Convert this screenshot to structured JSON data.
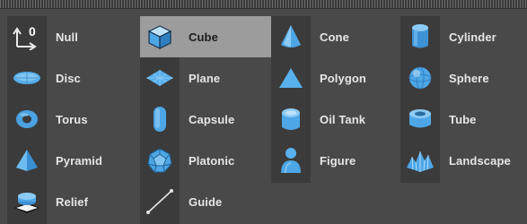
{
  "columns": [
    {
      "items": [
        {
          "label": "Null",
          "icon": "null-icon",
          "glyph": "0"
        },
        {
          "label": "Disc",
          "icon": "disc-icon"
        },
        {
          "label": "Torus",
          "icon": "torus-icon"
        },
        {
          "label": "Pyramid",
          "icon": "pyramid-icon"
        },
        {
          "label": "Relief",
          "icon": "relief-icon"
        }
      ]
    },
    {
      "items": [
        {
          "label": "Cube",
          "icon": "cube-icon",
          "selected": true
        },
        {
          "label": "Plane",
          "icon": "plane-icon"
        },
        {
          "label": "Capsule",
          "icon": "capsule-icon"
        },
        {
          "label": "Platonic",
          "icon": "platonic-icon"
        },
        {
          "label": "Guide",
          "icon": "guide-icon"
        }
      ]
    },
    {
      "items": [
        {
          "label": "Cone",
          "icon": "cone-icon"
        },
        {
          "label": "Polygon",
          "icon": "polygon-icon"
        },
        {
          "label": "Oil Tank",
          "icon": "oil-tank-icon"
        },
        {
          "label": "Figure",
          "icon": "figure-icon"
        }
      ]
    },
    {
      "items": [
        {
          "label": "Cylinder",
          "icon": "cylinder-icon"
        },
        {
          "label": "Sphere",
          "icon": "sphere-icon"
        },
        {
          "label": "Tube",
          "icon": "tube-icon"
        },
        {
          "label": "Landscape",
          "icon": "landscape-icon"
        }
      ]
    }
  ],
  "colors": {
    "icon_blue": "#4fa7e6",
    "selected_bg": "#9c9c9c",
    "panel_bg": "#494949"
  }
}
